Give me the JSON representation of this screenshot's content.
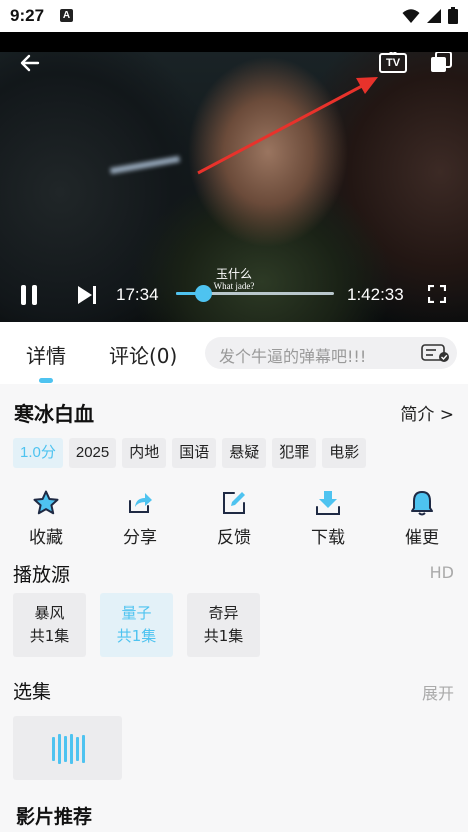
{
  "status_bar": {
    "time": "9:27",
    "notification_badge": "A",
    "icons": [
      "wifi-icon",
      "signal-icon",
      "battery-icon"
    ]
  },
  "player": {
    "subtitle_cn": "玉什么",
    "subtitle_en": "What jade?",
    "current_time": "17:34",
    "total_time": "1:42:33",
    "progress": 0.17,
    "tv_label": "TV",
    "accent_color": "#4ec3f0",
    "annotation_arrow_color": "#e8322b"
  },
  "tabs": {
    "details": "详情",
    "comments": "评论(0)"
  },
  "danmu": {
    "placeholder": "发个牛逼的弹幕吧!!!"
  },
  "info": {
    "title": "寒冰白血",
    "intro_link": "简介 >",
    "tags": [
      "1.0分",
      "2025",
      "内地",
      "国语",
      "悬疑",
      "犯罪",
      "电影"
    ]
  },
  "actions": [
    {
      "label": "收藏",
      "icon": "star-icon"
    },
    {
      "label": "分享",
      "icon": "share-icon"
    },
    {
      "label": "反馈",
      "icon": "edit-icon"
    },
    {
      "label": "下载",
      "icon": "download-icon"
    },
    {
      "label": "催更",
      "icon": "bell-icon"
    }
  ],
  "sources": {
    "title": "播放源",
    "quality": "HD",
    "items": [
      {
        "name": "暴风",
        "count": "共1集"
      },
      {
        "name": "量子",
        "count": "共1集"
      },
      {
        "name": "奇异",
        "count": "共1集"
      }
    ]
  },
  "episodes": {
    "title": "选集",
    "expand": "展开"
  },
  "recommend": {
    "title": "影片推荐"
  }
}
